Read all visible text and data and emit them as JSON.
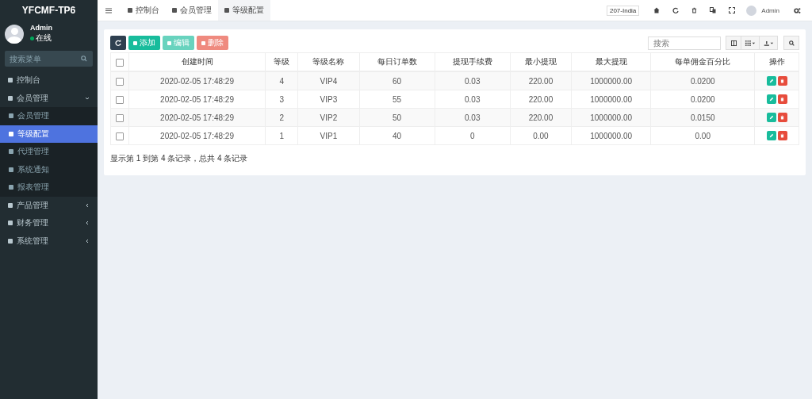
{
  "sidebar": {
    "logo": "YFCMF-TP6",
    "user": {
      "name": "Admin",
      "status": "在线"
    },
    "search": {
      "placeholder": "搜索菜单"
    },
    "items": [
      {
        "label": "控制台",
        "selected": false
      },
      {
        "label": "会员管理",
        "expanded": true,
        "selected": false,
        "children": [
          {
            "label": "会员管理",
            "selected": false
          },
          {
            "label": "等级配置",
            "selected": true
          },
          {
            "label": "代理管理",
            "selected": false
          },
          {
            "label": "系统通知",
            "selected": false
          },
          {
            "label": "报表管理",
            "selected": false
          }
        ]
      },
      {
        "label": "产品管理",
        "expanded": false,
        "selected": false
      },
      {
        "label": "财务管理",
        "expanded": false,
        "selected": false
      },
      {
        "label": "系统管理",
        "expanded": false,
        "selected": false
      }
    ]
  },
  "tabs": [
    {
      "label": "控制台",
      "selected": false
    },
    {
      "label": "会员管理",
      "selected": false
    },
    {
      "label": "等级配置",
      "selected": true
    }
  ],
  "header": {
    "server": "207-India",
    "user": "Admin"
  },
  "toolbar": {
    "buttons": [
      {
        "kind": "refresh",
        "disabled": false
      },
      {
        "kind": "add",
        "label": "添加",
        "disabled": false
      },
      {
        "kind": "edit",
        "label": "编辑",
        "disabled": true
      },
      {
        "kind": "delete",
        "label": "删除",
        "disabled": true
      }
    ],
    "search": {
      "placeholder": "搜索"
    }
  },
  "table": {
    "select_all_checked": false,
    "columns": [
      "创建时间",
      "等级",
      "等级名称",
      "每日订单数",
      "提现手续费",
      "最小提现",
      "最大提现",
      "每单佣金百分比",
      "操作"
    ],
    "rows": [
      {
        "checked": false,
        "cells": [
          "2020-02-05 17:48:29",
          "4",
          "VIP4",
          "60",
          "0.03",
          "220.00",
          "1000000.00",
          "0.0200"
        ]
      },
      {
        "checked": false,
        "cells": [
          "2020-02-05 17:48:29",
          "3",
          "VIP3",
          "55",
          "0.03",
          "220.00",
          "1000000.00",
          "0.0200"
        ]
      },
      {
        "checked": false,
        "cells": [
          "2020-02-05 17:48:29",
          "2",
          "VIP2",
          "50",
          "0.03",
          "220.00",
          "1000000.00",
          "0.0150"
        ]
      },
      {
        "checked": false,
        "cells": [
          "2020-02-05 17:48:29",
          "1",
          "VIP1",
          "40",
          "0",
          "0.00",
          "1000000.00",
          "0.00"
        ]
      }
    ]
  },
  "pagination_info": "显示第 1 到第 4 条记录，总共 4 条记录"
}
